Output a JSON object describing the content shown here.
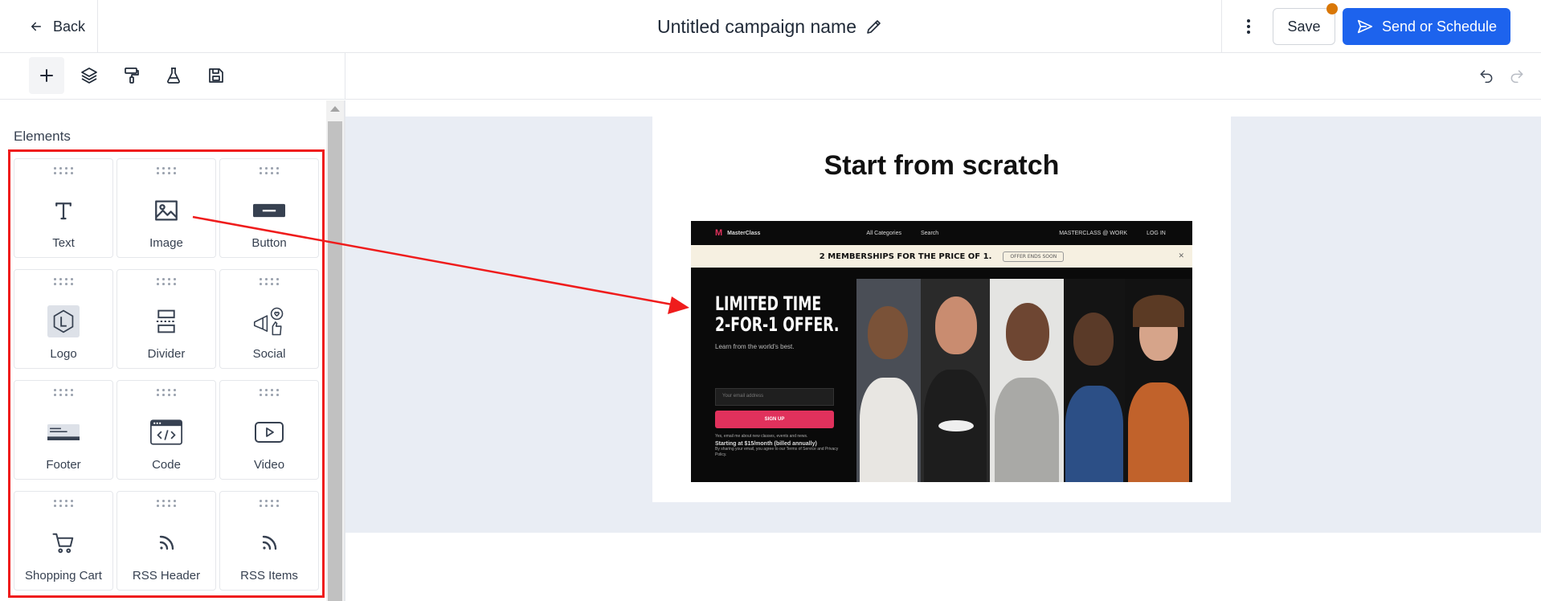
{
  "header": {
    "back_label": "Back",
    "campaign_title": "Untitled campaign name",
    "save_label": "Save",
    "send_label": "Send or Schedule",
    "accent": "#1d63ed",
    "save_badge_color": "#d97706"
  },
  "toolbar": {
    "tools": [
      "add-icon",
      "layers-icon",
      "paint-roller-icon",
      "flask-icon",
      "save-disk-icon"
    ],
    "active_tool": "add-icon",
    "history": [
      "undo-icon",
      "redo-icon"
    ]
  },
  "sidebar": {
    "section_title": "Elements",
    "elements": [
      {
        "label": "Text",
        "icon": "text-icon"
      },
      {
        "label": "Image",
        "icon": "image-icon"
      },
      {
        "label": "Button",
        "icon": "button-icon"
      },
      {
        "label": "Logo",
        "icon": "logo-icon"
      },
      {
        "label": "Divider",
        "icon": "divider-icon"
      },
      {
        "label": "Social",
        "icon": "social-icon"
      },
      {
        "label": "Footer",
        "icon": "footer-icon"
      },
      {
        "label": "Code",
        "icon": "code-icon"
      },
      {
        "label": "Video",
        "icon": "video-icon"
      },
      {
        "label": "Shopping Cart",
        "icon": "shopping-cart-icon"
      },
      {
        "label": "RSS Header",
        "icon": "rss-icon"
      },
      {
        "label": "RSS Items",
        "icon": "rss-icon"
      }
    ],
    "highlight_color": "#ef1c1c"
  },
  "canvas": {
    "background": "#e9edf4",
    "email_title": "Start from scratch",
    "hero": {
      "brand": "MasterClass",
      "nav_categories": "All Categories",
      "nav_search": "Search",
      "nav_work": "MASTERCLASS @ WORK",
      "nav_login": "LOG IN",
      "banner_text": "2 MEMBERSHIPS FOR THE PRICE OF 1.",
      "banner_button": "OFFER ENDS SOON",
      "headline_1": "LIMITED TIME",
      "headline_2": "2-FOR-1 OFFER.",
      "subline": "Learn from the world's best.",
      "email_placeholder": "Your email address",
      "signup_label": "SIGN UP",
      "fine_print": "Yes, email me about new classes, events and news.",
      "price_line": "Starting at $15/month (billed annually)",
      "legal": "By sharing your email, you agree to our Terms of Service and Privacy Policy."
    }
  }
}
